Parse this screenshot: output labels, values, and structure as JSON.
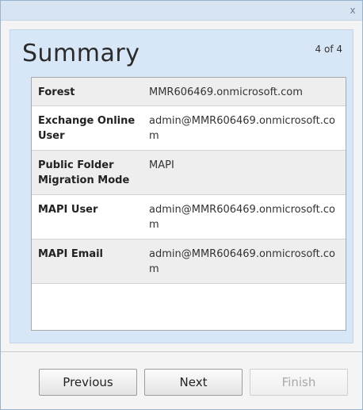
{
  "window": {
    "close_glyph": "x"
  },
  "header": {
    "title": "Summary",
    "page_indicator": "4 of 4"
  },
  "summary": {
    "rows": [
      {
        "label": "Forest",
        "value": "MMR606469.onmicrosoft.com"
      },
      {
        "label": "Exchange Online User",
        "value": "admin@MMR606469.onmicrosoft.com"
      },
      {
        "label": "Public Folder Migration Mode",
        "value": "MAPI"
      },
      {
        "label": "MAPI User",
        "value": "admin@MMR606469.onmicrosoft.com"
      },
      {
        "label": "MAPI Email",
        "value": "admin@MMR606469.onmicrosoft.com"
      }
    ]
  },
  "footer": {
    "previous_label": "Previous",
    "next_label": "Next",
    "finish_label": "Finish"
  },
  "colors": {
    "panel": "#d8e7f7",
    "title_bar": "#d7e4f2",
    "row_alt": "#eeeeee"
  }
}
